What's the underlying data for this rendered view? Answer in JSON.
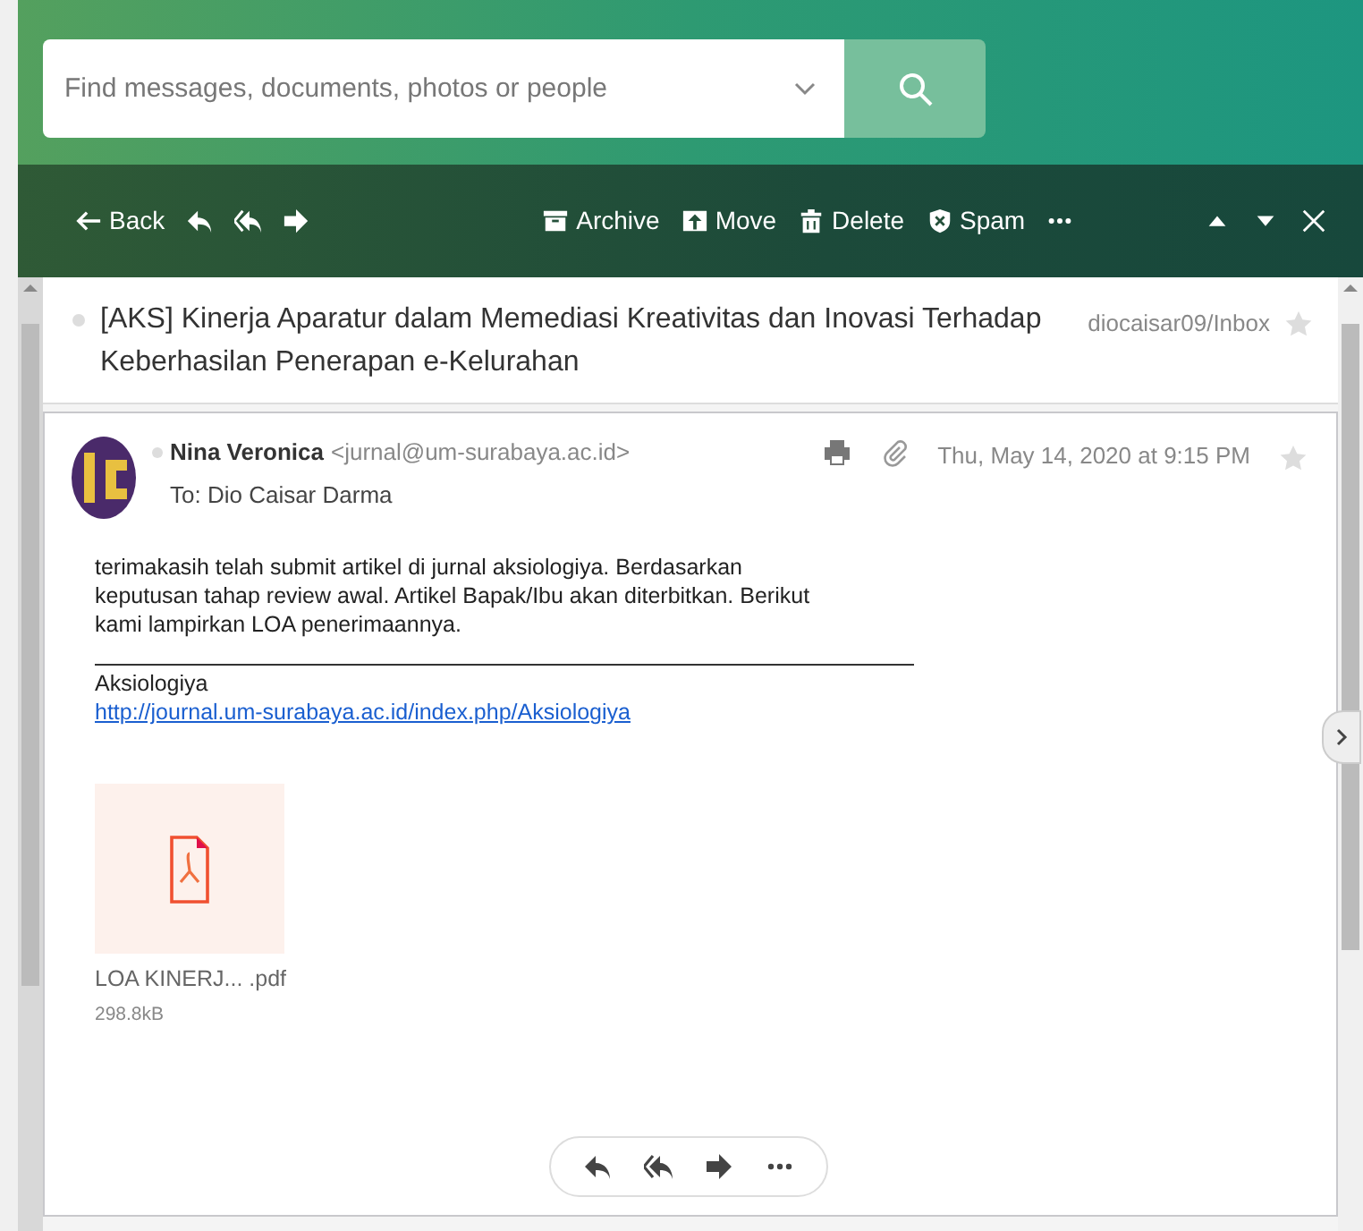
{
  "search": {
    "placeholder": "Find messages, documents, photos or people"
  },
  "toolbar": {
    "back": "Back",
    "archive": "Archive",
    "move": "Move",
    "delete": "Delete",
    "spam": "Spam"
  },
  "message": {
    "subject": "[AKS] Kinerja Aparatur dalam Memediasi Kreativitas dan Inovasi Terhadap Keberhasilan Penerapan e-Kelurahan",
    "folder": "diocaisar09/Inbox",
    "starred": false,
    "sender": "Nina Veronica",
    "sender_email": "<jurnal@um-surabaya.ac.id>",
    "to": "To: Dio Caisar Darma",
    "date": "Thu, May 14, 2020 at 9:15 PM",
    "message_starred": false,
    "body": "terimakasih telah submit artikel di jurnal aksiologiya. Berdasarkan\nkeputusan tahap review awal. Artikel Bapak/Ibu akan diterbitkan. Berikut\nkami lampirkan LOA penerimaannya.",
    "signature": "Aksiologiya",
    "link": "http://journal.um-surabaya.ac.id/index.php/Aksiologiya",
    "attachment": {
      "name": "LOA KINERJ... .pdf",
      "size": "298.8kB"
    }
  }
}
